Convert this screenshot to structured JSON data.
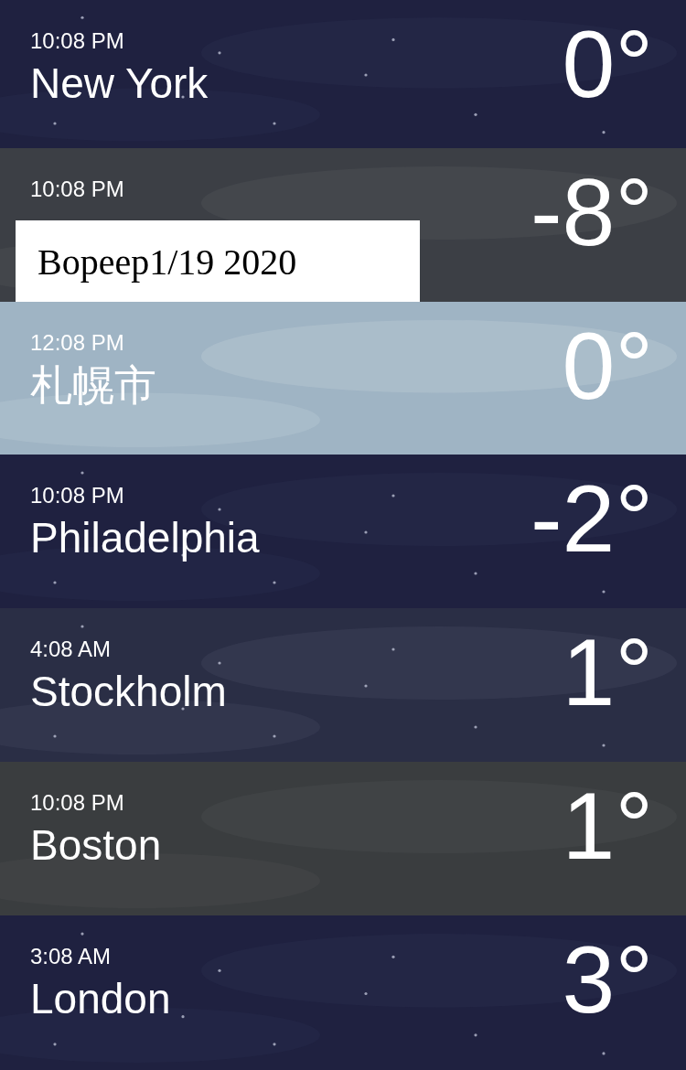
{
  "cities": [
    {
      "time": "10:08 PM",
      "city": "New York",
      "temperature": "0°",
      "kind": "night"
    },
    {
      "time": "10:08 PM",
      "temperature": "-8°",
      "kind": "overcast",
      "note": "Bopeep1/19 2020"
    },
    {
      "time": "12:08 PM",
      "city": "札幌市",
      "temperature": "0°",
      "kind": "day"
    },
    {
      "time": "10:08 PM",
      "city": "Philadelphia",
      "temperature": "-2°",
      "kind": "night"
    },
    {
      "time": "4:08 AM",
      "city": "Stockholm",
      "temperature": "1°",
      "kind": "windy"
    },
    {
      "time": "10:08 PM",
      "city": "Boston",
      "temperature": "1°",
      "kind": "cloudy"
    },
    {
      "time": "3:08 AM",
      "city": "London",
      "temperature": "3°",
      "kind": "night"
    }
  ]
}
